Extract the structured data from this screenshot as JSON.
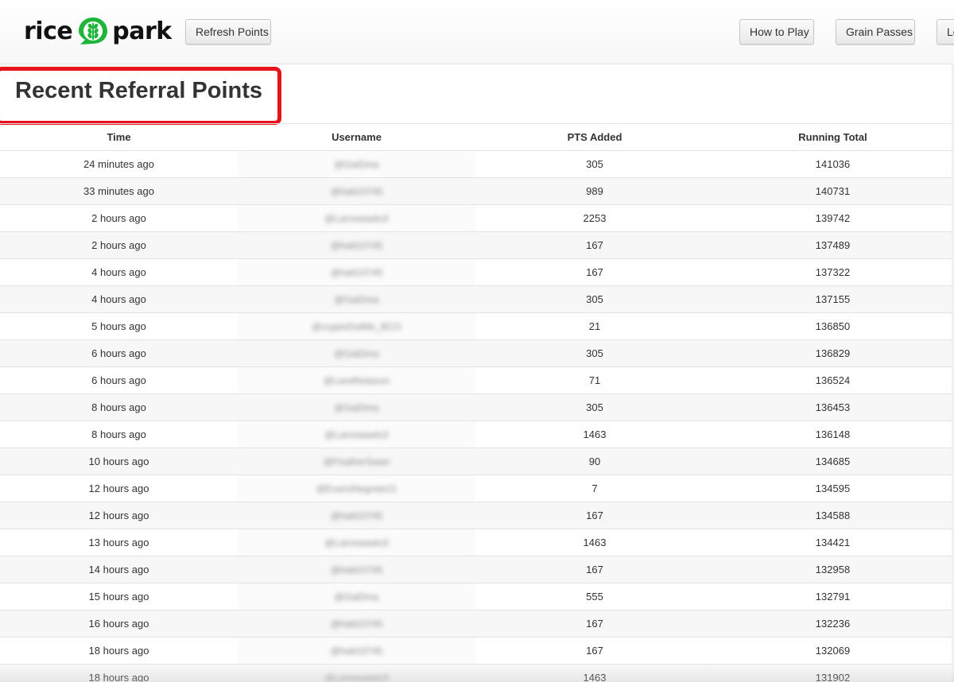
{
  "brand": {
    "name_left": "rice",
    "name_right": "park",
    "accent_color": "#1fb53a",
    "logo_icon": "wheat-icon"
  },
  "header": {
    "refresh_label": "Refresh Points",
    "how_to_play_label": "How to Play",
    "grain_passes_label": "Grain Passes",
    "cut_off_label": "Le"
  },
  "title": "Recent Referral Points",
  "highlight_color": "#e8121a",
  "table": {
    "columns": [
      "Time",
      "Username",
      "PTS Added",
      "Running Total"
    ],
    "rows": [
      {
        "time": "24 minutes ago",
        "username": "@GaiDma",
        "pts": "305",
        "total": "141036"
      },
      {
        "time": "33 minutes ago",
        "username": "@hatt10745",
        "pts": "989",
        "total": "140731"
      },
      {
        "time": "2 hours ago",
        "username": "@Larrewawlo3",
        "pts": "2253",
        "total": "139742"
      },
      {
        "time": "2 hours ago",
        "username": "@hatt10745",
        "pts": "167",
        "total": "137489"
      },
      {
        "time": "4 hours ago",
        "username": "@hatt10745",
        "pts": "167",
        "total": "137322"
      },
      {
        "time": "4 hours ago",
        "username": "@GaiDma",
        "pts": "305",
        "total": "137155"
      },
      {
        "time": "5 hours ago",
        "username": "@cryptoDotMe_BCO",
        "pts": "21",
        "total": "136850"
      },
      {
        "time": "6 hours ago",
        "username": "@GaiDma",
        "pts": "305",
        "total": "136829"
      },
      {
        "time": "6 hours ago",
        "username": "@LandNotason",
        "pts": "71",
        "total": "136524"
      },
      {
        "time": "8 hours ago",
        "username": "@GaiDma",
        "pts": "305",
        "total": "136453"
      },
      {
        "time": "8 hours ago",
        "username": "@Larrewawlo3",
        "pts": "1463",
        "total": "136148"
      },
      {
        "time": "10 hours ago",
        "username": "@FeatherSwan",
        "pts": "90",
        "total": "134685"
      },
      {
        "time": "12 hours ago",
        "username": "@EvansNegrete21",
        "pts": "7",
        "total": "134595"
      },
      {
        "time": "12 hours ago",
        "username": "@hatt10745",
        "pts": "167",
        "total": "134588"
      },
      {
        "time": "13 hours ago",
        "username": "@Larrewawlo3",
        "pts": "1463",
        "total": "134421"
      },
      {
        "time": "14 hours ago",
        "username": "@hatt10745",
        "pts": "167",
        "total": "132958"
      },
      {
        "time": "15 hours ago",
        "username": "@GaiDma",
        "pts": "555",
        "total": "132791"
      },
      {
        "time": "16 hours ago",
        "username": "@hatt10745",
        "pts": "167",
        "total": "132236"
      },
      {
        "time": "18 hours ago",
        "username": "@hatt10745",
        "pts": "167",
        "total": "132069"
      },
      {
        "time": "18 hours ago",
        "username": "@Larrewawlo3",
        "pts": "1463",
        "total": "131902"
      }
    ]
  }
}
